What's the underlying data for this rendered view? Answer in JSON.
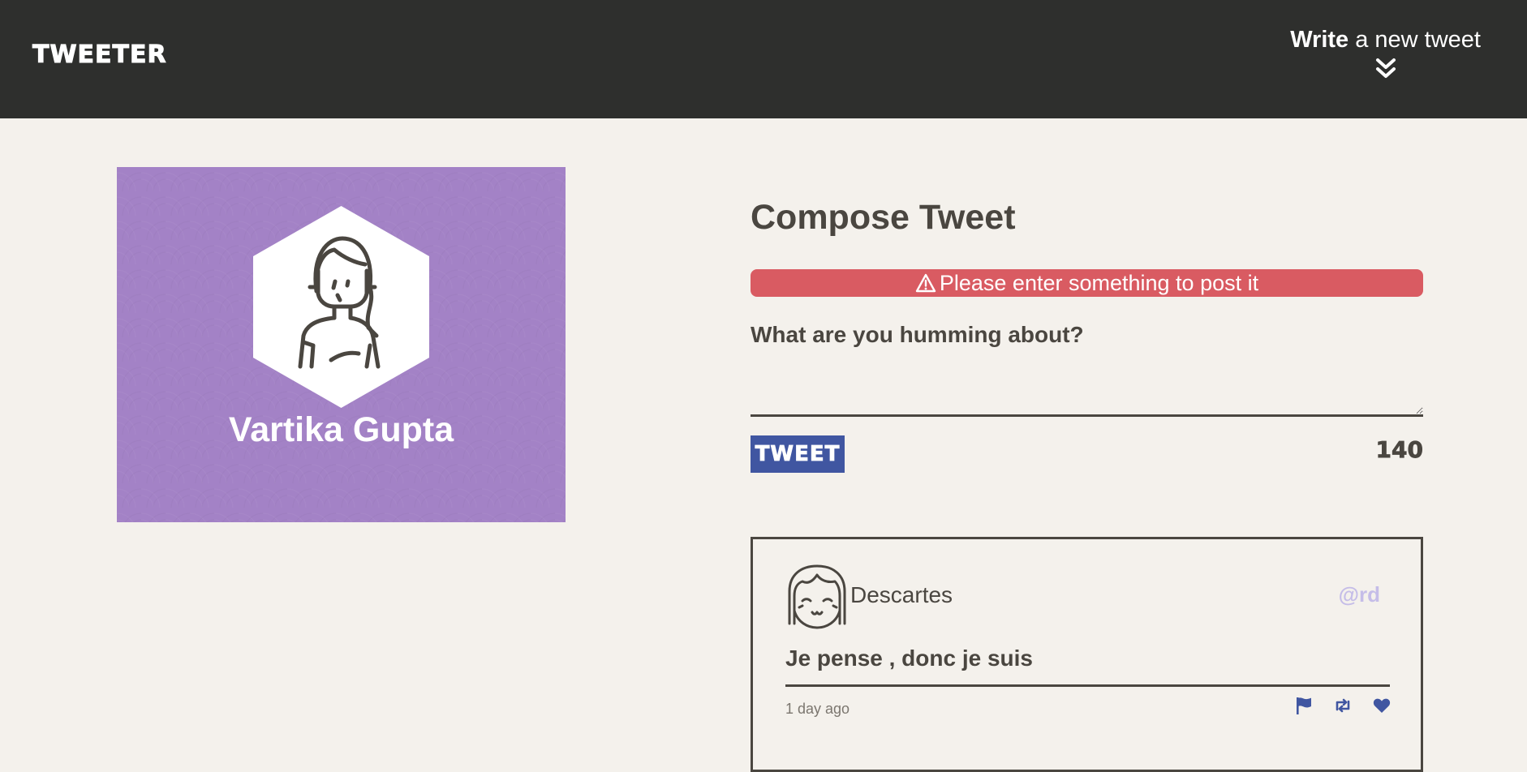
{
  "navbar": {
    "brand": "TWEETER",
    "write_bold": "Write",
    "write_rest": " a new tweet",
    "chevron_icon": "double-chevron-down-icon"
  },
  "profile": {
    "name": "Vartika Gupta",
    "avatar_icon": "woman-avatar-icon",
    "background_color": "#a382c6"
  },
  "compose": {
    "title": "Compose Tweet",
    "error_message": "Please enter something to post it",
    "error_icon": "warning-icon",
    "error_color": "#d95b62",
    "prompt": "What are you humming about?",
    "input_value": "",
    "button_label": "TWEET",
    "button_color": "#4056a1",
    "counter": "140"
  },
  "tweets": [
    {
      "author": "Descartes",
      "handle": "@rd",
      "avatar_icon": "girl-avatar-icon",
      "text": "Je pense , donc je suis",
      "time": "1 day ago",
      "actions": [
        "flag-icon",
        "retweet-icon",
        "heart-icon"
      ]
    }
  ]
}
